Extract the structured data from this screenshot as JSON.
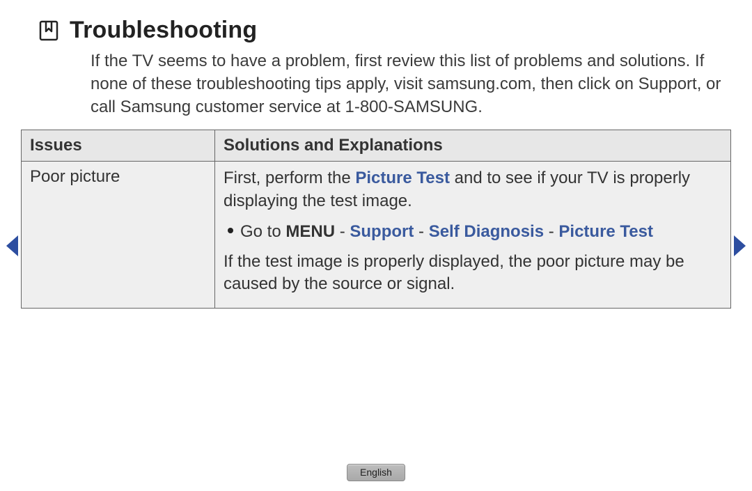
{
  "heading": {
    "title": "Troubleshooting"
  },
  "intro": "If the TV seems to have a problem, first review this list of problems and solutions. If none of these troubleshooting tips apply, visit samsung.com, then click on Support, or call Samsung customer service at 1-800-SAMSUNG.",
  "table": {
    "headers": {
      "issues": "Issues",
      "solutions": "Solutions and Explanations"
    },
    "rows": [
      {
        "issue": "Poor picture",
        "solution": {
          "para1_prefix": "First, perform the ",
          "para1_highlight": "Picture Test",
          "para1_suffix": " and to see if your TV is properly displaying the test image.",
          "bullet_goto": "Go to ",
          "bullet_menu": "MENU",
          "bullet_sep": " - ",
          "bullet_support": "Support",
          "bullet_self": "Self Diagnosis",
          "bullet_picture": "Picture Test",
          "para2": "If the test image is properly displayed, the poor picture may be caused by the source or signal."
        }
      }
    ]
  },
  "footer": {
    "language": "English"
  }
}
